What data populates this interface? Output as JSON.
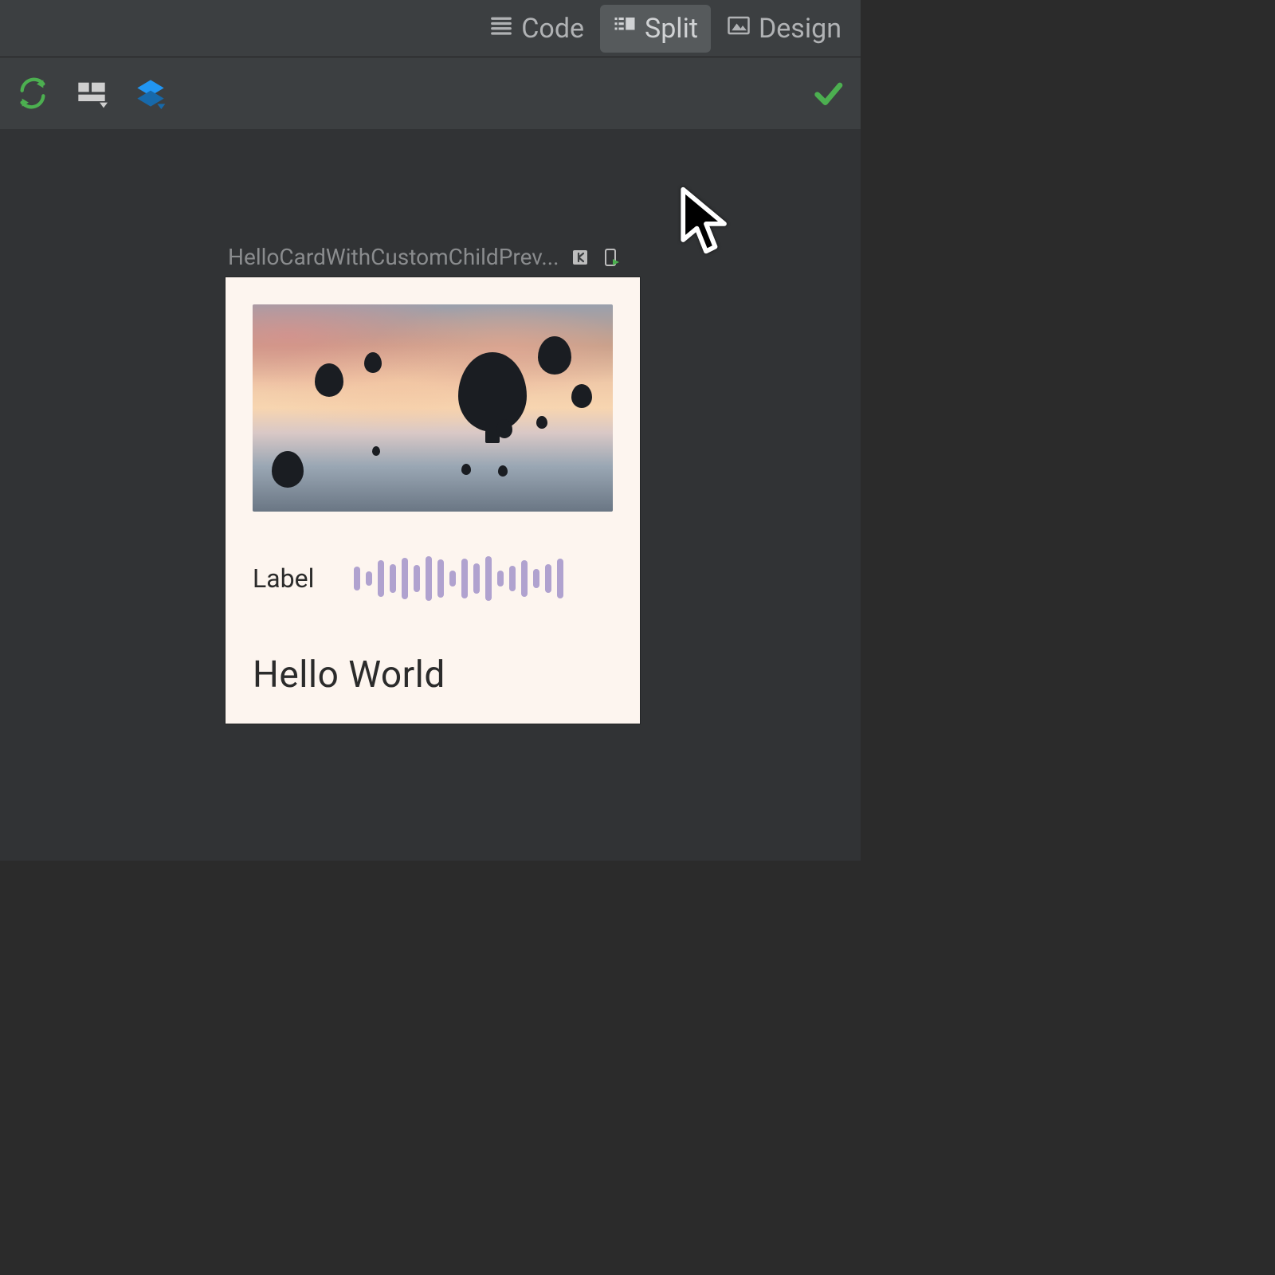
{
  "topbar": {
    "tabs": [
      {
        "label": "Code",
        "icon": "lines-icon",
        "active": false
      },
      {
        "label": "Split",
        "icon": "split-icon",
        "active": true
      },
      {
        "label": "Design",
        "icon": "image-icon",
        "active": false
      }
    ]
  },
  "toolbar": {
    "refresh": "refresh",
    "layout": "layout",
    "layers": "layers",
    "status": "ok"
  },
  "preview": {
    "title": "HelloCardWithCustomChildPrev...",
    "interactive_icon": "interactive",
    "device_icon": "device-run"
  },
  "card": {
    "label": "Label",
    "title": "Hello World",
    "wave_heights": [
      30,
      18,
      46,
      36,
      52,
      34,
      56,
      48,
      20,
      50,
      38,
      56,
      20,
      32,
      46,
      24,
      36,
      50
    ],
    "accent": "#b0a2cf"
  }
}
